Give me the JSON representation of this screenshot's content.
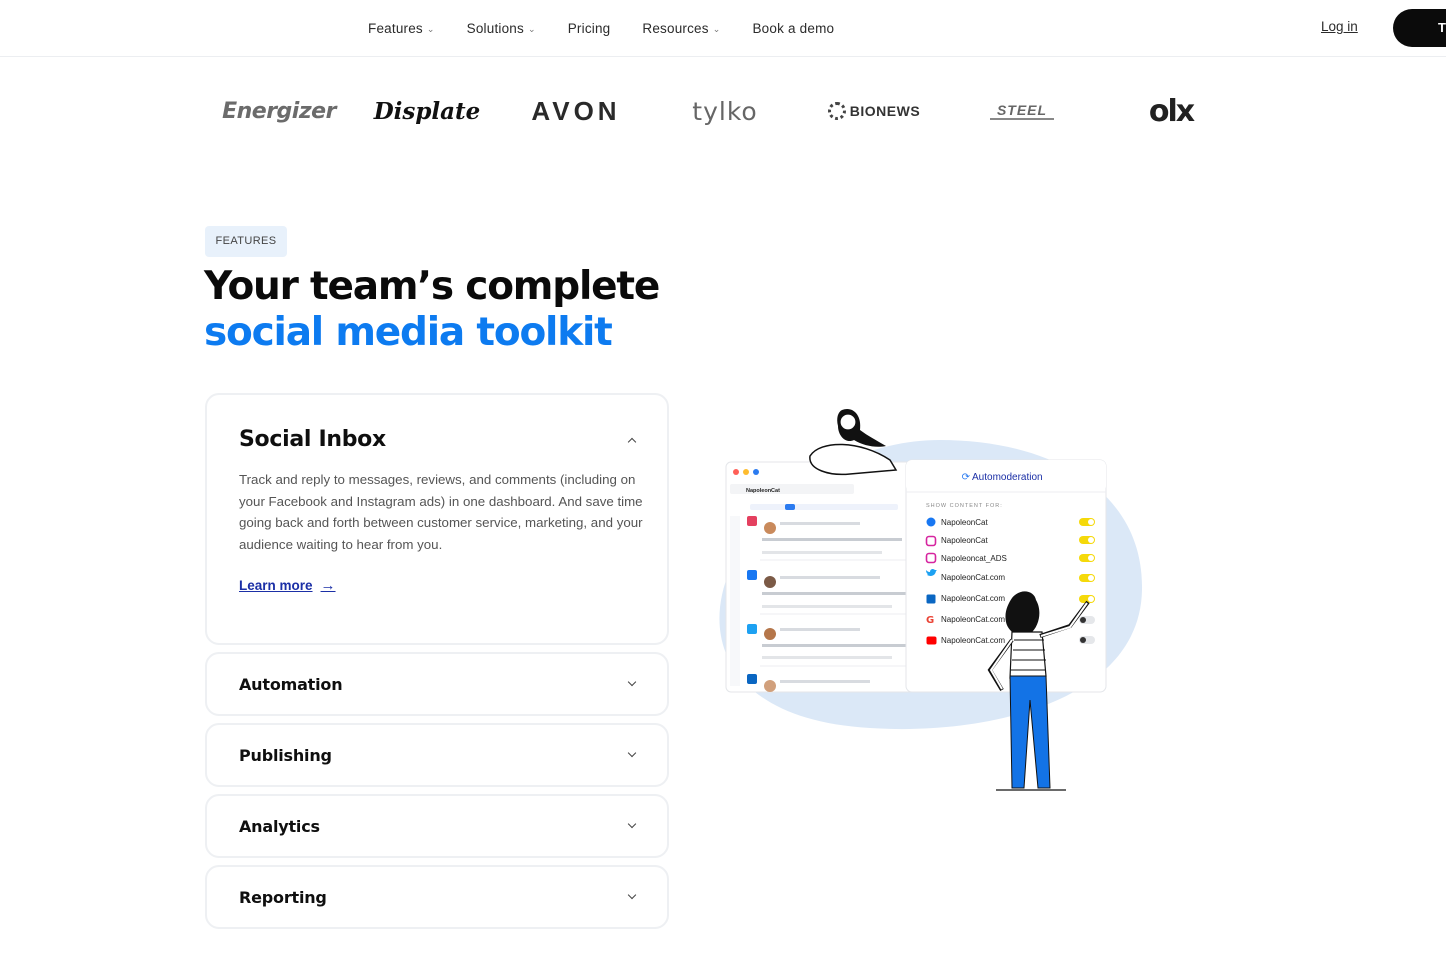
{
  "nav": {
    "items": [
      {
        "label": "Features",
        "dropdown": true
      },
      {
        "label": "Solutions",
        "dropdown": true
      },
      {
        "label": "Pricing",
        "dropdown": false
      },
      {
        "label": "Resources",
        "dropdown": true
      },
      {
        "label": "Book a demo",
        "dropdown": false
      }
    ],
    "login_label": "Log in",
    "cta_label": "T"
  },
  "logos": [
    "Energizer",
    "Displate",
    "AVON",
    "tylko",
    "BIONEWS",
    "STEEL",
    "olx"
  ],
  "section": {
    "tag": "FEATURES",
    "headline_line1": "Your team’s complete",
    "headline_line2": "social media toolkit",
    "accent_color": "#0d7bf0"
  },
  "accordion": {
    "open": {
      "title": "Social Inbox",
      "description": "Track and reply to messages, reviews, and comments (including on your Facebook and Instagram ads) in one dashboard. And save time going back and forth between customer service, marketing, and your audience waiting to hear from you.",
      "link_label": "Learn more"
    },
    "closed": [
      {
        "title": "Automation"
      },
      {
        "title": "Publishing"
      },
      {
        "title": "Analytics"
      },
      {
        "title": "Reporting"
      }
    ]
  },
  "illustration": {
    "panel_title": "Automoderation",
    "panel_subtitle": "SHOW CONTENT FOR:",
    "inbox_account": "NapoleonCat",
    "accounts": [
      {
        "name": "NapoleonCat",
        "network": "facebook",
        "color": "#1877f2",
        "enabled": true
      },
      {
        "name": "NapoleonCat",
        "network": "instagram",
        "color": "#d6249f",
        "enabled": true
      },
      {
        "name": "Napoleoncat_ADS",
        "network": "instagram",
        "color": "#d6249f",
        "enabled": true
      },
      {
        "name": "NapoleonCat.com",
        "network": "twitter",
        "color": "#1da1f2",
        "enabled": true
      },
      {
        "name": "NapoleonCat.com",
        "network": "linkedin",
        "color": "#0a66c2",
        "enabled": true
      },
      {
        "name": "NapoleonCat.com",
        "network": "google",
        "color": "#ea4335",
        "enabled": false
      },
      {
        "name": "NapoleonCat.com",
        "network": "youtube",
        "color": "#ff0000",
        "enabled": false
      }
    ]
  }
}
